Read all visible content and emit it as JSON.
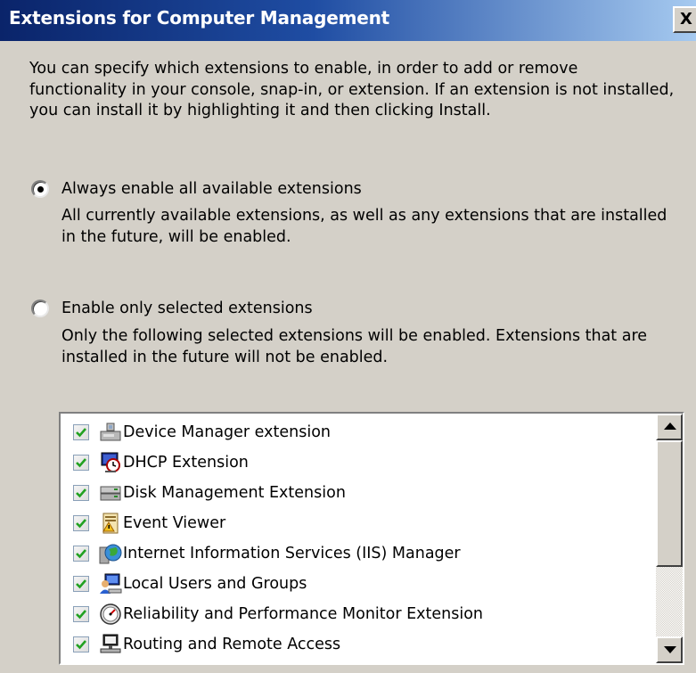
{
  "window": {
    "title": "Extensions for Computer Management",
    "close_label": "X"
  },
  "intro_text": "You can specify which extensions to enable, in order to add or remove functionality in your console, snap-in, or extension. If an extension is not installed, you can install it by highlighting it and then clicking Install.",
  "options": {
    "always": {
      "label": "Always enable all available extensions",
      "description": "All currently available extensions, as well as any extensions that are installed in the future, will be enabled.",
      "selected": true
    },
    "selected_only": {
      "label": "Enable only selected extensions",
      "description": "Only the following selected extensions will be enabled. Extensions that are installed in the future will not be enabled.",
      "selected": false
    }
  },
  "extensions": [
    {
      "label": "Device Manager extension",
      "checked": true,
      "icon": "device-manager-icon"
    },
    {
      "label": "DHCP Extension",
      "checked": true,
      "icon": "dhcp-icon"
    },
    {
      "label": "Disk Management Extension",
      "checked": true,
      "icon": "disk-management-icon"
    },
    {
      "label": "Event Viewer",
      "checked": true,
      "icon": "event-viewer-icon"
    },
    {
      "label": "Internet Information Services (IIS) Manager",
      "checked": true,
      "icon": "iis-manager-icon"
    },
    {
      "label": "Local Users and Groups",
      "checked": true,
      "icon": "local-users-icon"
    },
    {
      "label": "Reliability and Performance Monitor Extension",
      "checked": true,
      "icon": "performance-monitor-icon"
    },
    {
      "label": "Routing and Remote Access",
      "checked": true,
      "icon": "routing-icon"
    }
  ],
  "colors": {
    "titlebar_start": "#0a246a",
    "titlebar_end": "#a6caf0",
    "dialog_bg": "#d4d0c8",
    "checkmark": "#21a121"
  }
}
